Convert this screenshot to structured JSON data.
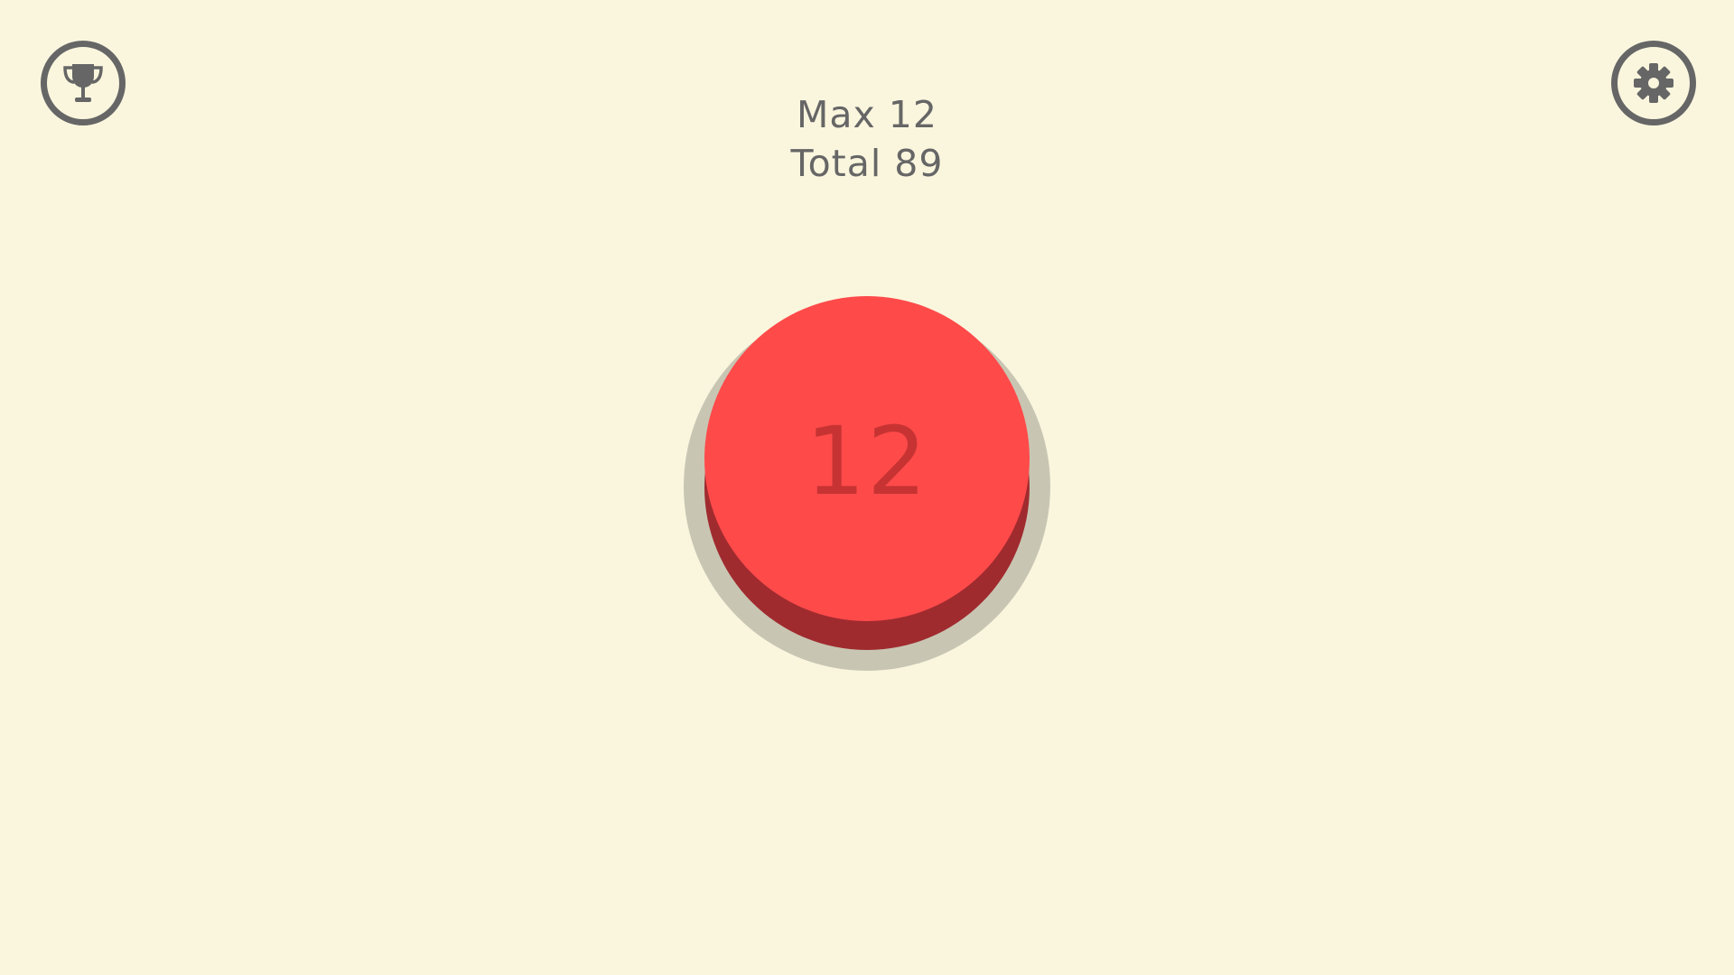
{
  "header": {
    "max_label": "Max 12",
    "total_label": "Total 89"
  },
  "buttons": {
    "leaderboard_icon": "trophy-icon",
    "settings_icon": "gear-icon"
  },
  "counter": {
    "value": "12"
  },
  "colors": {
    "background": "#faf6de",
    "button_top": "#ff4a4a",
    "button_side": "#a02b2f",
    "button_shadow": "#c8c6b3",
    "icon_gray": "#666666",
    "count_text": "#c73333"
  }
}
